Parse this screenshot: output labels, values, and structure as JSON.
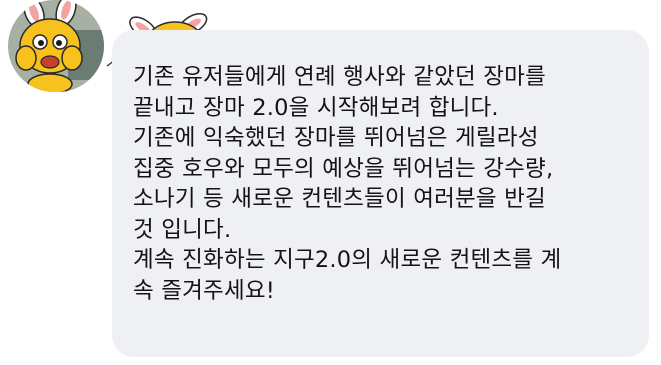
{
  "chat": {
    "message_lines": [
      "기존 유저들에게 연례 행사와 같았던 장마를",
      "끝내고 장마 2.0을 시작해보려 합니다.",
      "기존에 익숙했던 장마를 뛰어넘은 게릴라성",
      "집중 호우와 모두의 예상을 뛰어넘는 강수량,",
      "소나기 등 새로운 컨텐츠들이 여러분을 반길",
      "것 입니다.",
      "계속 진화하는 지구2.0의 새로운 컨텐츠를 계",
      "속 즐겨주세요!"
    ]
  },
  "colors": {
    "bubble": "#eef0f3",
    "text": "#141414",
    "character_yellow": "#f7c21e"
  },
  "icons": {
    "avatar": "yellow-bunny-character-avatar",
    "sticker": "yellow-bunny-character-sticker"
  }
}
